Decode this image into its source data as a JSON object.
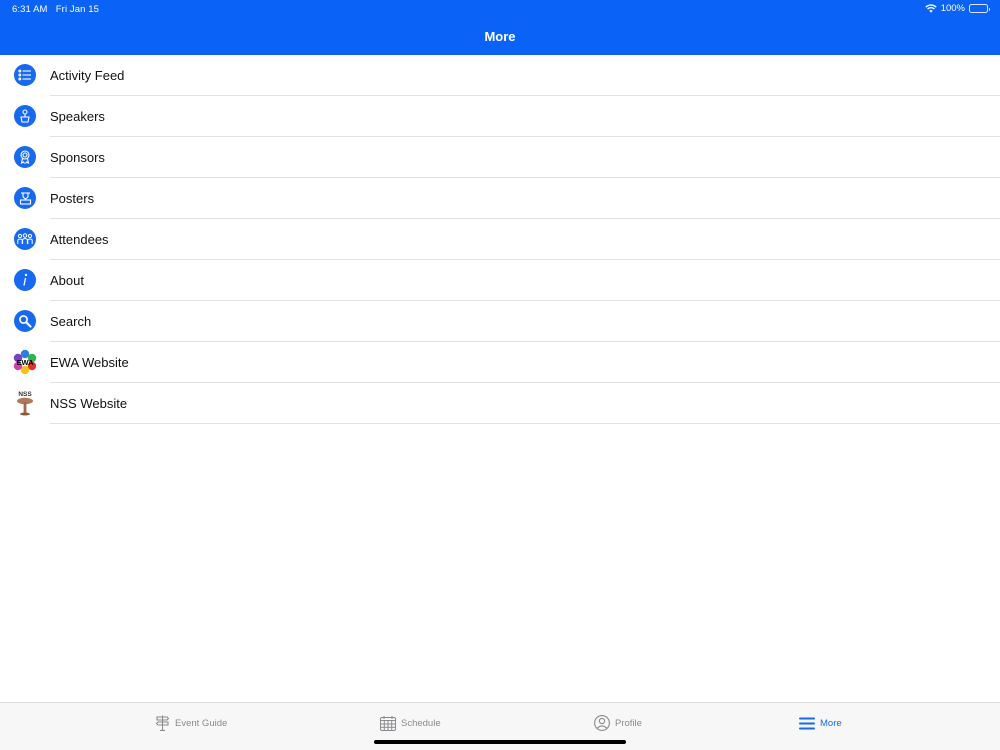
{
  "status_bar": {
    "time": "6:31 AM",
    "date": "Fri Jan 15",
    "battery": "100%"
  },
  "nav": {
    "title": "More"
  },
  "menu": [
    {
      "label": "Activity Feed",
      "icon": "list-icon"
    },
    {
      "label": "Speakers",
      "icon": "speaker-icon"
    },
    {
      "label": "Sponsors",
      "icon": "ribbon-icon"
    },
    {
      "label": "Posters",
      "icon": "easel-icon"
    },
    {
      "label": "Attendees",
      "icon": "people-icon"
    },
    {
      "label": "About",
      "icon": "info-icon"
    },
    {
      "label": "Search",
      "icon": "search-icon"
    },
    {
      "label": "EWA Website",
      "icon": "ewa-logo"
    },
    {
      "label": "NSS Website",
      "icon": "nss-logo"
    }
  ],
  "tabs": [
    {
      "label": "Event Guide",
      "icon": "signpost-icon",
      "active": false
    },
    {
      "label": "Schedule",
      "icon": "calendar-icon",
      "active": false
    },
    {
      "label": "Profile",
      "icon": "person-icon",
      "active": false
    },
    {
      "label": "More",
      "icon": "menu-icon",
      "active": true
    }
  ],
  "colors": {
    "accent": "#0a63f6",
    "icon_blue": "#1769f0",
    "tab_inactive": "#8a8a8e"
  }
}
